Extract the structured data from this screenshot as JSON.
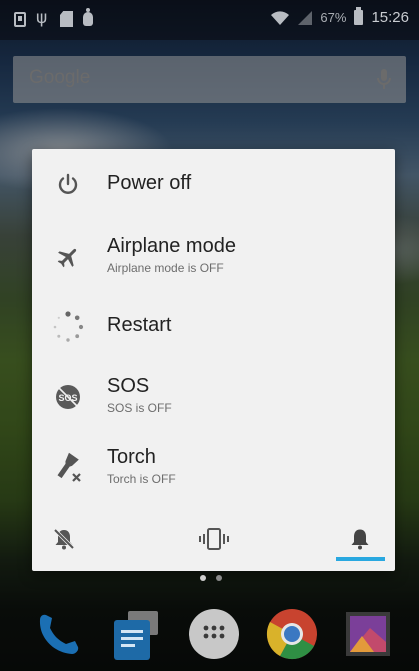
{
  "status_bar": {
    "left_icons": [
      "sim-card-icon",
      "usb-icon",
      "sd-card-icon",
      "android-debug-icon"
    ],
    "battery_percent": "67%",
    "time": "15:26",
    "right_icons": [
      "wifi-icon",
      "signal-icon",
      "battery-icon"
    ]
  },
  "search_bar": {
    "label": "Google",
    "icon": "mic-icon"
  },
  "power_menu": {
    "items": [
      {
        "icon": "power-icon",
        "title": "Power off",
        "subtitle": ""
      },
      {
        "icon": "airplane-icon",
        "title": "Airplane mode",
        "subtitle": "Airplane mode is OFF"
      },
      {
        "icon": "restart-icon",
        "title": "Restart",
        "subtitle": ""
      },
      {
        "icon": "sos-icon",
        "title": "SOS",
        "subtitle": "SOS is OFF"
      },
      {
        "icon": "torch-icon",
        "title": "Torch",
        "subtitle": "Torch is OFF"
      }
    ],
    "sound_modes": [
      {
        "icon": "silent-bell-icon",
        "selected": false
      },
      {
        "icon": "vibrate-icon",
        "selected": false
      },
      {
        "icon": "bell-icon",
        "selected": true
      }
    ],
    "accent_color": "#29a8e0"
  },
  "home_pages": {
    "count": 2,
    "current": 1
  },
  "dock": {
    "apps": [
      "phone-icon",
      "messaging-icon",
      "app-drawer-icon",
      "chrome-icon",
      "gallery-icon"
    ]
  }
}
